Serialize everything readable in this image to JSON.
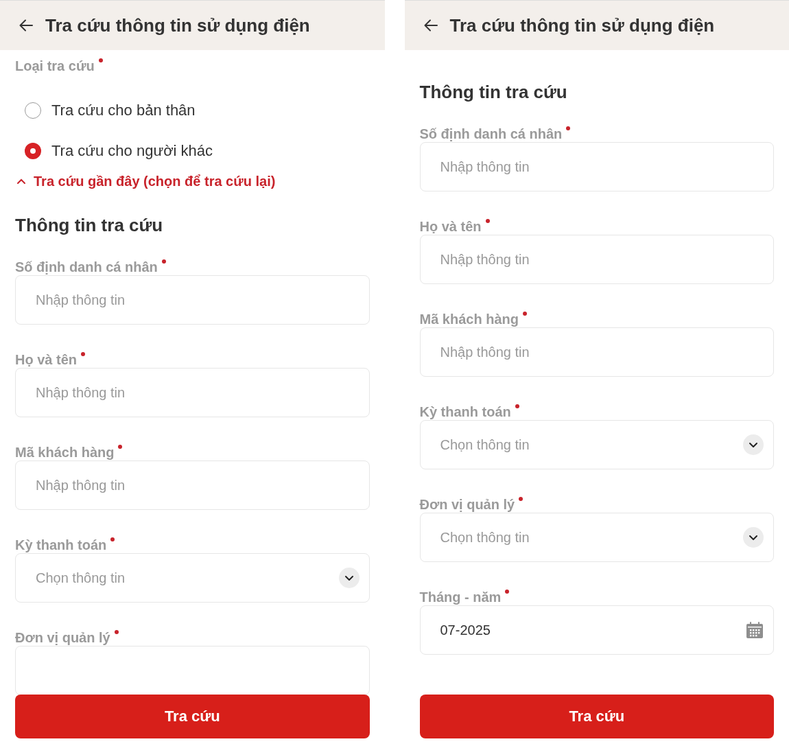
{
  "screens": [
    {
      "header": {
        "title": "Tra cứu thông tin sử dụng điện"
      },
      "lookup_type": {
        "label": "Loại tra cứu",
        "required": true,
        "options": [
          {
            "label": "Tra cứu cho bản thân",
            "selected": false
          },
          {
            "label": "Tra cứu cho người khác",
            "selected": true
          }
        ]
      },
      "recent_link": {
        "label": "Tra cứu gần đây (chọn để tra cứu lại)",
        "expanded": true
      },
      "section_title": "Thông tin tra cứu",
      "fields": [
        {
          "kind": "text",
          "label": "Số định danh cá nhân",
          "required": true,
          "placeholder": "Nhập thông tin"
        },
        {
          "kind": "text",
          "label": "Họ và tên",
          "required": true,
          "placeholder": "Nhập thông tin"
        },
        {
          "kind": "text",
          "label": "Mã khách hàng",
          "required": true,
          "placeholder": "Nhập thông tin"
        },
        {
          "kind": "select",
          "label": "Kỳ thanh toán",
          "required": true,
          "placeholder": "Chọn thông tin"
        },
        {
          "kind": "select",
          "label": "Đơn vị quản lý",
          "required": true
        }
      ],
      "submit_button": "Tra cứu"
    },
    {
      "header": {
        "title": "Tra cứu thông tin sử dụng điện"
      },
      "section_title": "Thông tin tra cứu",
      "fields": [
        {
          "kind": "text",
          "label": "Số định danh cá nhân",
          "required": true,
          "placeholder": "Nhập thông tin"
        },
        {
          "kind": "text",
          "label": "Họ và tên",
          "required": true,
          "placeholder": "Nhập thông tin"
        },
        {
          "kind": "text",
          "label": "Mã khách hàng",
          "required": true,
          "placeholder": "Nhập thông tin"
        },
        {
          "kind": "select",
          "label": "Kỳ thanh toán",
          "required": true,
          "placeholder": "Chọn thông tin"
        },
        {
          "kind": "select",
          "label": "Đơn vị quản lý",
          "required": true,
          "placeholder": "Chọn thông tin"
        },
        {
          "kind": "date",
          "label": "Tháng - năm",
          "required": true,
          "value": "07-2025"
        }
      ],
      "submit_button": "Tra cứu"
    }
  ]
}
